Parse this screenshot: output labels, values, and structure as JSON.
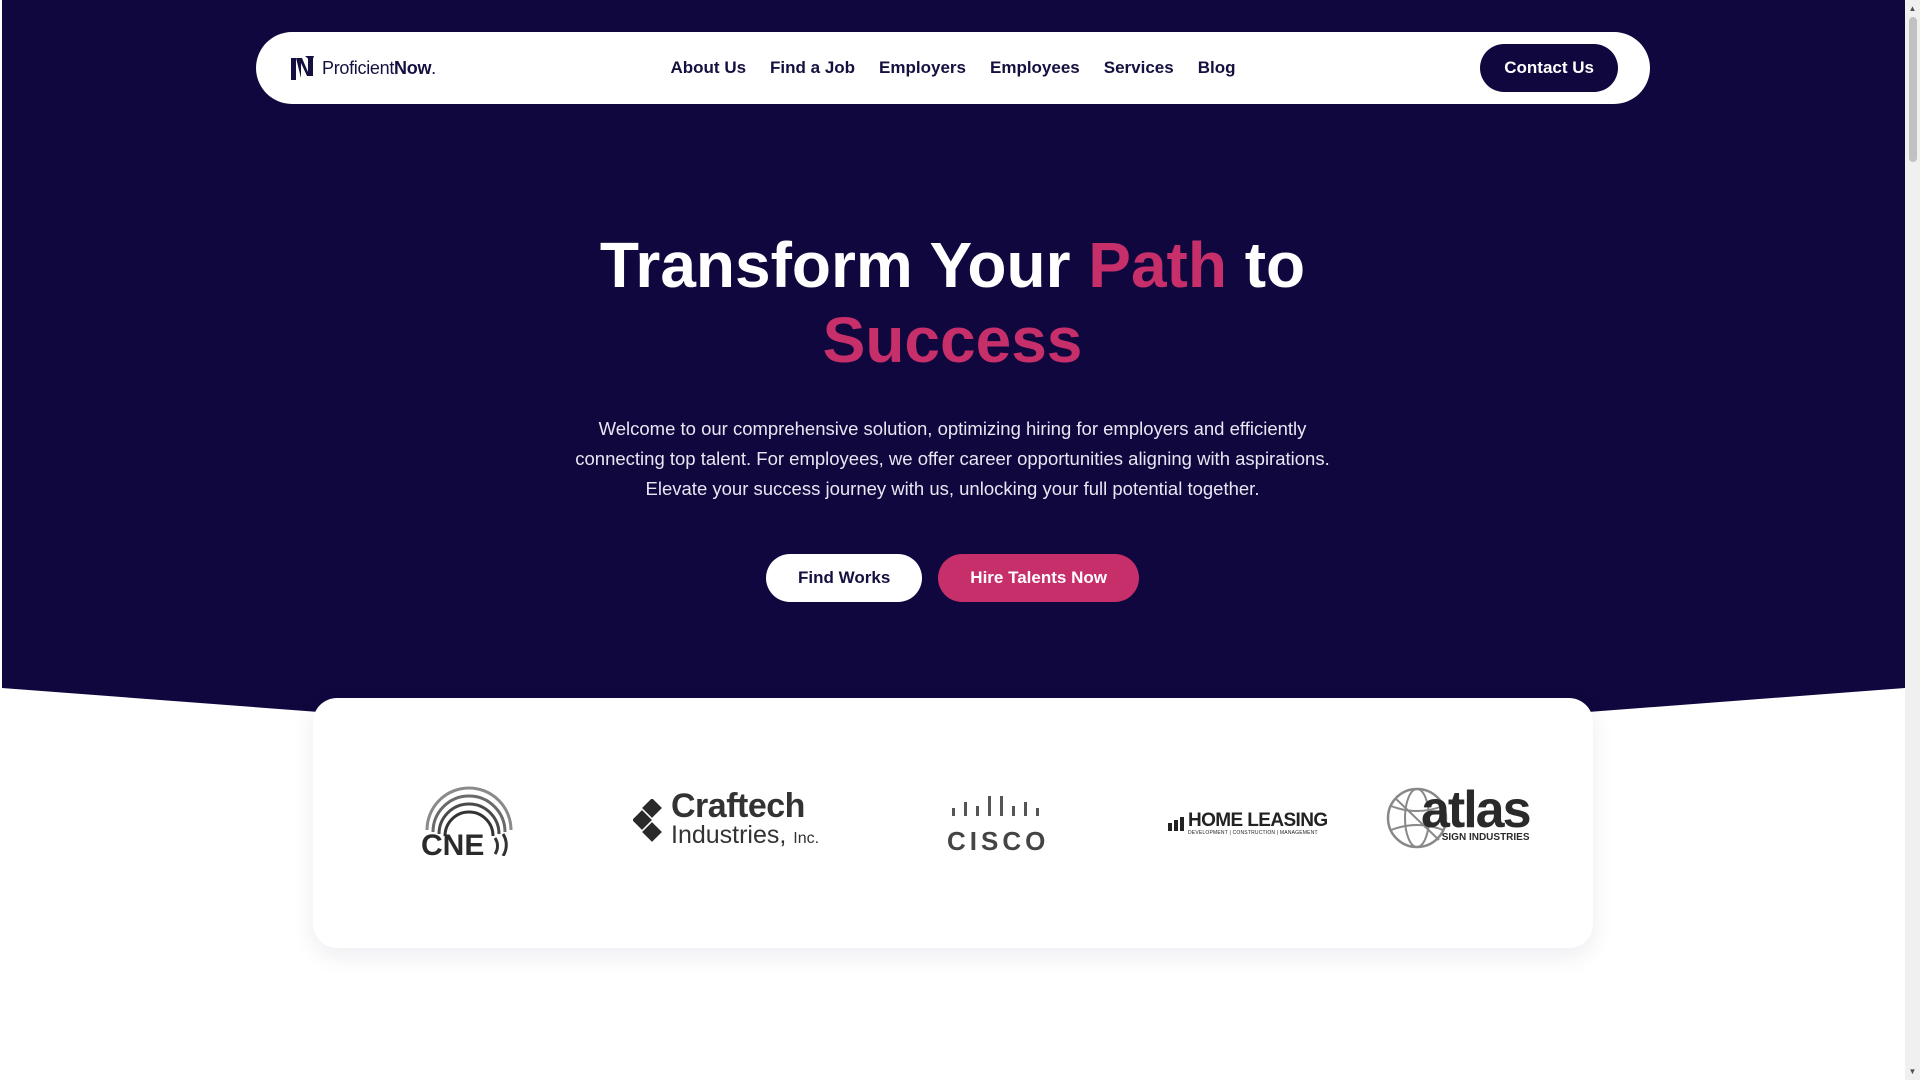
{
  "brand": {
    "logo_text_regular": "Proficient",
    "logo_text_bold": "Now",
    "logo_text_dot": "."
  },
  "nav": {
    "items": [
      {
        "label": "About Us"
      },
      {
        "label": "Find a Job"
      },
      {
        "label": "Employers"
      },
      {
        "label": "Employees"
      },
      {
        "label": "Services"
      },
      {
        "label": "Blog"
      }
    ],
    "contact_label": "Contact Us"
  },
  "hero": {
    "title_part1": "Transform Your ",
    "title_accent1": "Path",
    "title_part2": " to",
    "title_accent2": "Success",
    "description": "Welcome to our comprehensive solution, optimizing hiring for employers and efficiently connecting top talent. For employees, we offer career opportunities aligning with aspirations. Elevate your success journey with us, unlocking your full potential together.",
    "primary_button": "Find Works",
    "secondary_button": "Hire Talents Now"
  },
  "clients": {
    "logos": [
      {
        "name": "CNE"
      },
      {
        "name": "Craftech",
        "sub": "Industries,",
        "suffix": "Inc."
      },
      {
        "name": "CISCO"
      },
      {
        "name": "HOME LEASING",
        "tag": "DEVELOPMENT | CONSTRUCTION | MANAGEMENT"
      },
      {
        "name": "atlas",
        "tag": "SIGN INDUSTRIES"
      }
    ]
  },
  "colors": {
    "navy": "#11073f",
    "accent": "#c72f6a",
    "white": "#ffffff"
  }
}
